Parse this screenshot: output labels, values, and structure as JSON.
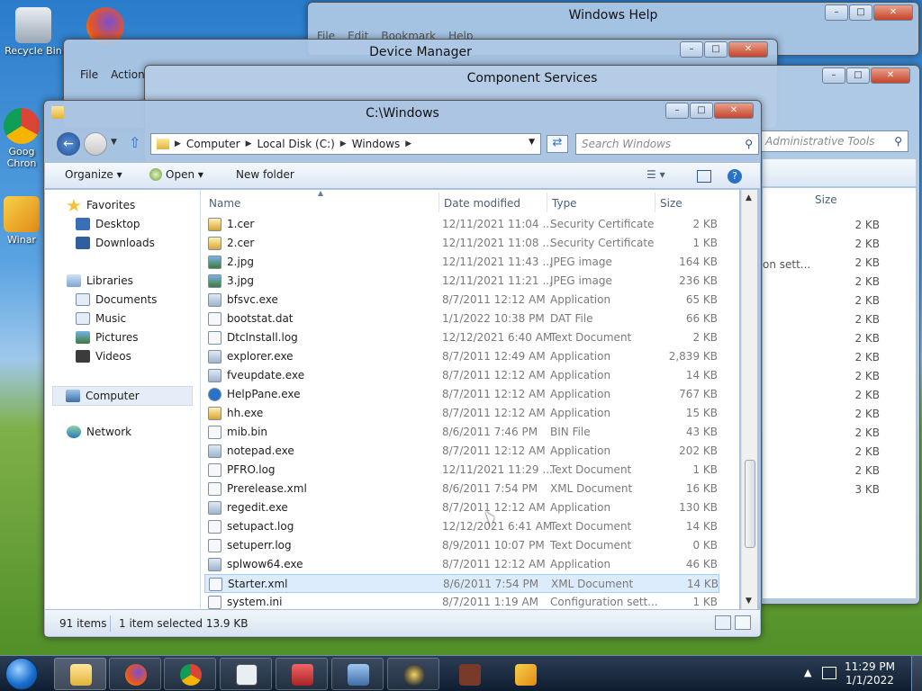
{
  "desktop": {
    "icons": [
      {
        "label": "Recycle Bin"
      },
      {
        "label": "Goog Chron"
      },
      {
        "label": "Winar"
      }
    ]
  },
  "background_windows": {
    "help": {
      "title": "Windows Help",
      "menu": [
        "File",
        "Edit",
        "Bookmark",
        "Help"
      ]
    },
    "device_manager": {
      "title": "Device Manager",
      "menu": [
        "File",
        "Action"
      ]
    },
    "component_services": {
      "title": "Component Services",
      "search_placeholder": "Administrative Tools",
      "size_header": "Size",
      "sizes": [
        "2 KB",
        "2 KB",
        "2 KB",
        "2 KB",
        "2 KB",
        "2 KB",
        "2 KB",
        "2 KB",
        "2 KB",
        "2 KB",
        "2 KB",
        "2 KB",
        "2 KB",
        "2 KB",
        "3 KB"
      ],
      "partial_text": "on sett..."
    }
  },
  "explorer": {
    "title": "C:\\Windows",
    "breadcrumb": [
      "Computer",
      "Local Disk (C:)",
      "Windows"
    ],
    "search_placeholder": "Search Windows",
    "toolbar": {
      "organize": "Organize",
      "open": "Open",
      "new_folder": "New folder"
    },
    "nav": {
      "favorites": "Favorites",
      "desktop": "Desktop",
      "downloads": "Downloads",
      "libraries": "Libraries",
      "documents": "Documents",
      "music": "Music",
      "pictures": "Pictures",
      "videos": "Videos",
      "computer": "Computer",
      "network": "Network"
    },
    "columns": {
      "name": "Name",
      "date": "Date modified",
      "type": "Type",
      "size": "Size"
    },
    "files": [
      {
        "name": "1.cer",
        "date": "12/11/2021 11:04 ...",
        "type": "Security Certificate",
        "size": "2 KB",
        "icon": "cert"
      },
      {
        "name": "2.cer",
        "date": "12/11/2021 11:08 ...",
        "type": "Security Certificate",
        "size": "1 KB",
        "icon": "cert"
      },
      {
        "name": "2.jpg",
        "date": "12/11/2021 11:43 ...",
        "type": "JPEG image",
        "size": "164 KB",
        "icon": "img"
      },
      {
        "name": "3.jpg",
        "date": "12/11/2021 11:21 ...",
        "type": "JPEG image",
        "size": "236 KB",
        "icon": "img"
      },
      {
        "name": "bfsvc.exe",
        "date": "8/7/2011 12:12 AM",
        "type": "Application",
        "size": "65 KB",
        "icon": "app"
      },
      {
        "name": "bootstat.dat",
        "date": "1/1/2022 10:38 PM",
        "type": "DAT File",
        "size": "66 KB",
        "icon": "doc"
      },
      {
        "name": "DtcInstall.log",
        "date": "12/12/2021 6:40 AM",
        "type": "Text Document",
        "size": "2 KB",
        "icon": "doc"
      },
      {
        "name": "explorer.exe",
        "date": "8/7/2011 12:49 AM",
        "type": "Application",
        "size": "2,839 KB",
        "icon": "app"
      },
      {
        "name": "fveupdate.exe",
        "date": "8/7/2011 12:12 AM",
        "type": "Application",
        "size": "14 KB",
        "icon": "app"
      },
      {
        "name": "HelpPane.exe",
        "date": "8/7/2011 12:12 AM",
        "type": "Application",
        "size": "767 KB",
        "icon": "help"
      },
      {
        "name": "hh.exe",
        "date": "8/7/2011 12:12 AM",
        "type": "Application",
        "size": "15 KB",
        "icon": "cert"
      },
      {
        "name": "mib.bin",
        "date": "8/6/2011 7:46 PM",
        "type": "BIN File",
        "size": "43 KB",
        "icon": "doc"
      },
      {
        "name": "notepad.exe",
        "date": "8/7/2011 12:12 AM",
        "type": "Application",
        "size": "202 KB",
        "icon": "app"
      },
      {
        "name": "PFRO.log",
        "date": "12/11/2021 11:29 ...",
        "type": "Text Document",
        "size": "1 KB",
        "icon": "doc"
      },
      {
        "name": "Prerelease.xml",
        "date": "8/6/2011 7:54 PM",
        "type": "XML Document",
        "size": "16 KB",
        "icon": "doc"
      },
      {
        "name": "regedit.exe",
        "date": "8/7/2011 12:12 AM",
        "type": "Application",
        "size": "130 KB",
        "icon": "app"
      },
      {
        "name": "setupact.log",
        "date": "12/12/2021 6:41 AM",
        "type": "Text Document",
        "size": "14 KB",
        "icon": "doc"
      },
      {
        "name": "setuperr.log",
        "date": "8/9/2011 10:07 PM",
        "type": "Text Document",
        "size": "0 KB",
        "icon": "doc"
      },
      {
        "name": "splwow64.exe",
        "date": "8/7/2011 12:12 AM",
        "type": "Application",
        "size": "46 KB",
        "icon": "app"
      },
      {
        "name": "Starter.xml",
        "date": "8/6/2011 7:54 PM",
        "type": "XML Document",
        "size": "14 KB",
        "icon": "doc",
        "selected": true
      },
      {
        "name": "system.ini",
        "date": "8/7/2011 1:19 AM",
        "type": "Configuration sett...",
        "size": "1 KB",
        "icon": "doc"
      }
    ],
    "status": {
      "count": "91 items",
      "selection": "1 item selected  13.9 KB"
    }
  },
  "taskbar": {
    "time": "11:29 PM",
    "date": "1/1/2022"
  },
  "colors": {
    "selection": "#dcecfc",
    "accent": "#2a72c8"
  }
}
